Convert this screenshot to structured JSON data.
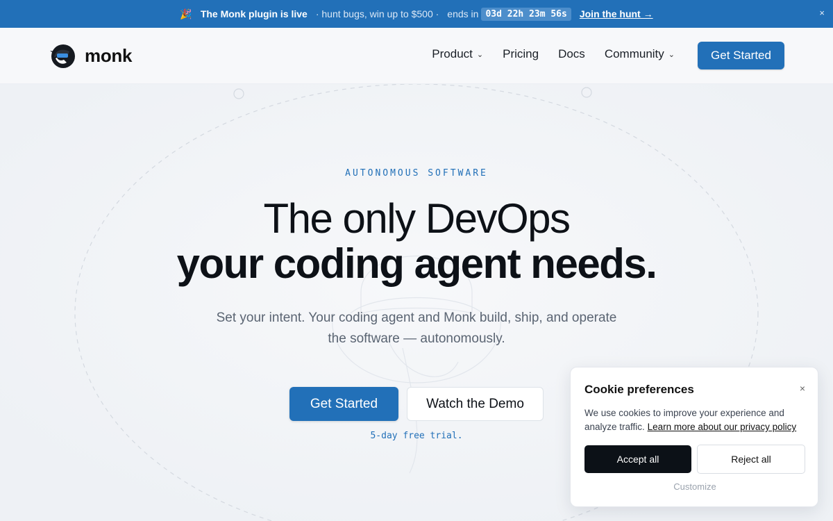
{
  "announcement": {
    "emoji": "🎉",
    "headline": "The Monk plugin is live",
    "detail": "· hunt bugs, win up to $500 ·",
    "ends_label": "ends in",
    "countdown": "03d 22h 23m 56s",
    "link": "Join the hunt →",
    "close": "×"
  },
  "header": {
    "brand": "monk",
    "nav": [
      {
        "label": "Product",
        "has_menu": true
      },
      {
        "label": "Pricing",
        "has_menu": false
      },
      {
        "label": "Docs",
        "has_menu": false
      },
      {
        "label": "Community",
        "has_menu": true
      }
    ],
    "chevron": "⌄",
    "cta": "Get Started"
  },
  "hero": {
    "eyebrow": "AUTONOMOUS SOFTWARE",
    "title_line1": "The only DevOps",
    "title_line2": "your coding agent needs.",
    "subtitle": "Set your intent. Your coding agent and Monk build, ship, and operate the software — autonomously.",
    "primary_cta": "Get Started",
    "secondary_cta": "Watch the Demo",
    "trial_note": "5-day free trial."
  },
  "cookie": {
    "title": "Cookie preferences",
    "close": "×",
    "body": "We use cookies to improve your experience and analyze traffic.",
    "link": "Learn more about our privacy policy",
    "accept": "Accept all",
    "reject": "Reject all",
    "customize": "Customize"
  },
  "colors": {
    "brand_blue": "#2270b8",
    "dark": "#0c1117",
    "background": "#f3f5f8"
  }
}
